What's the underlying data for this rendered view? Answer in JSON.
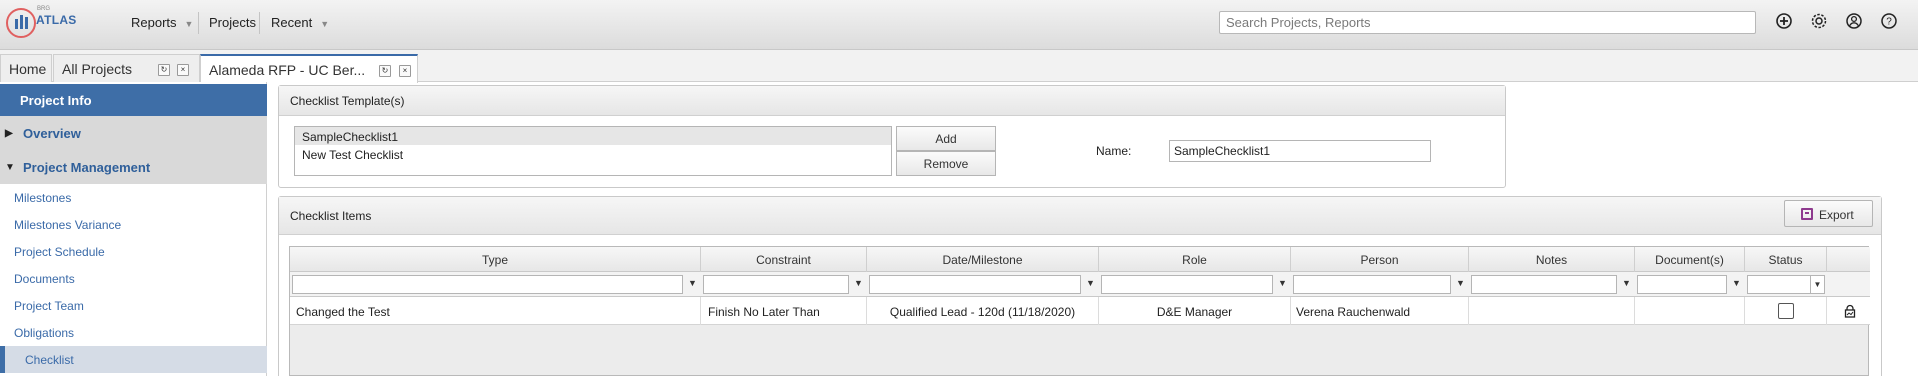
{
  "app": {
    "logo_sub": "BRG",
    "logo_text": "ATLAS"
  },
  "nav": {
    "reports": "Reports",
    "projects": "Projects",
    "recent": "Recent",
    "search_placeholder": "Search Projects, Reports"
  },
  "tabs": [
    {
      "label": "Home"
    },
    {
      "label": "All Projects"
    },
    {
      "label": "Alameda RFP - UC Ber..."
    }
  ],
  "sidebar": {
    "header": "Project Info",
    "sections": [
      {
        "label": "Overview",
        "expanded": false
      },
      {
        "label": "Project Management",
        "expanded": true
      }
    ],
    "items": [
      {
        "label": "Milestones"
      },
      {
        "label": "Milestones Variance"
      },
      {
        "label": "Project Schedule"
      },
      {
        "label": "Documents"
      },
      {
        "label": "Project Team"
      },
      {
        "label": "Obligations"
      },
      {
        "label": "Checklist",
        "active": true
      }
    ]
  },
  "templates_panel": {
    "title": "Checklist Template(s)",
    "list": [
      "SampleChecklist1",
      "New Test Checklist"
    ],
    "selected_index": 0,
    "add_label": "Add",
    "remove_label": "Remove",
    "name_label": "Name:",
    "name_value": "SampleChecklist1"
  },
  "items_panel": {
    "title": "Checklist Items",
    "export_label": "Export",
    "columns": [
      "Type",
      "Constraint",
      "Date/Milestone",
      "Role",
      "Person",
      "Notes",
      "Document(s)",
      "Status",
      ""
    ],
    "rows": [
      {
        "type": "Changed the Test",
        "constraint": "Finish No Later Than",
        "date_milestone": "Qualified Lead - 120d (11/18/2020)",
        "role": "D&E Manager",
        "person": "Verena Rauchenwald",
        "notes": "",
        "documents": "",
        "status_checked": false
      }
    ]
  },
  "colors": {
    "accent": "#3e6ea7",
    "link": "#3a6aa8",
    "export_icon": "#8e3a8e"
  }
}
